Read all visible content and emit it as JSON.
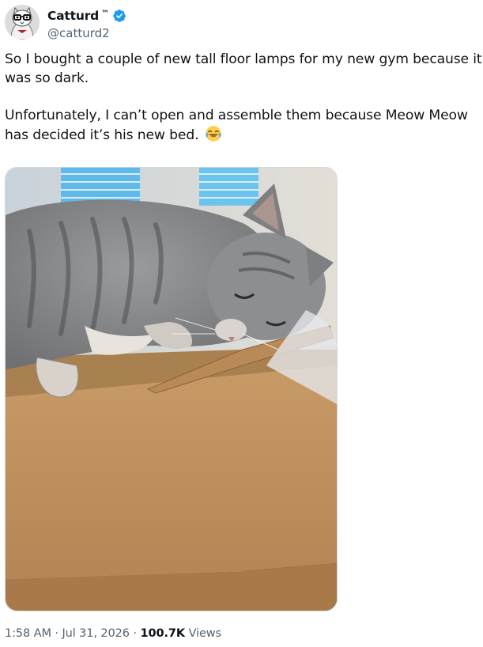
{
  "author": {
    "display_name": "Catturd",
    "trademark": "™",
    "handle": "@catturd2",
    "verified": true,
    "avatar_icon": "cat-avatar-icon",
    "verified_color": "#1d9bf0"
  },
  "tweet": {
    "paragraphs": [
      {
        "lines": [
          "So I bought a couple of new tall floor lamps for my new gym because it",
          "was so dark."
        ]
      },
      {
        "lines": [
          "Unfortunately, I can’t open and assemble them because Meow Meow",
          "has decided it’s his new bed."
        ],
        "trailing_emoji": "face-with-tears-of-joy-emoji"
      }
    ]
  },
  "media": {
    "type": "photo",
    "subject": "gray tabby cat lying on a cardboard box"
  },
  "meta": {
    "time": "1:58 AM",
    "separator": "·",
    "date": "Jul 31, 2026",
    "views_count": "100.7K",
    "views_label": "Views"
  },
  "colors": {
    "text": "#0f1419",
    "secondary_text": "#536471",
    "accent": "#1d9bf0"
  }
}
